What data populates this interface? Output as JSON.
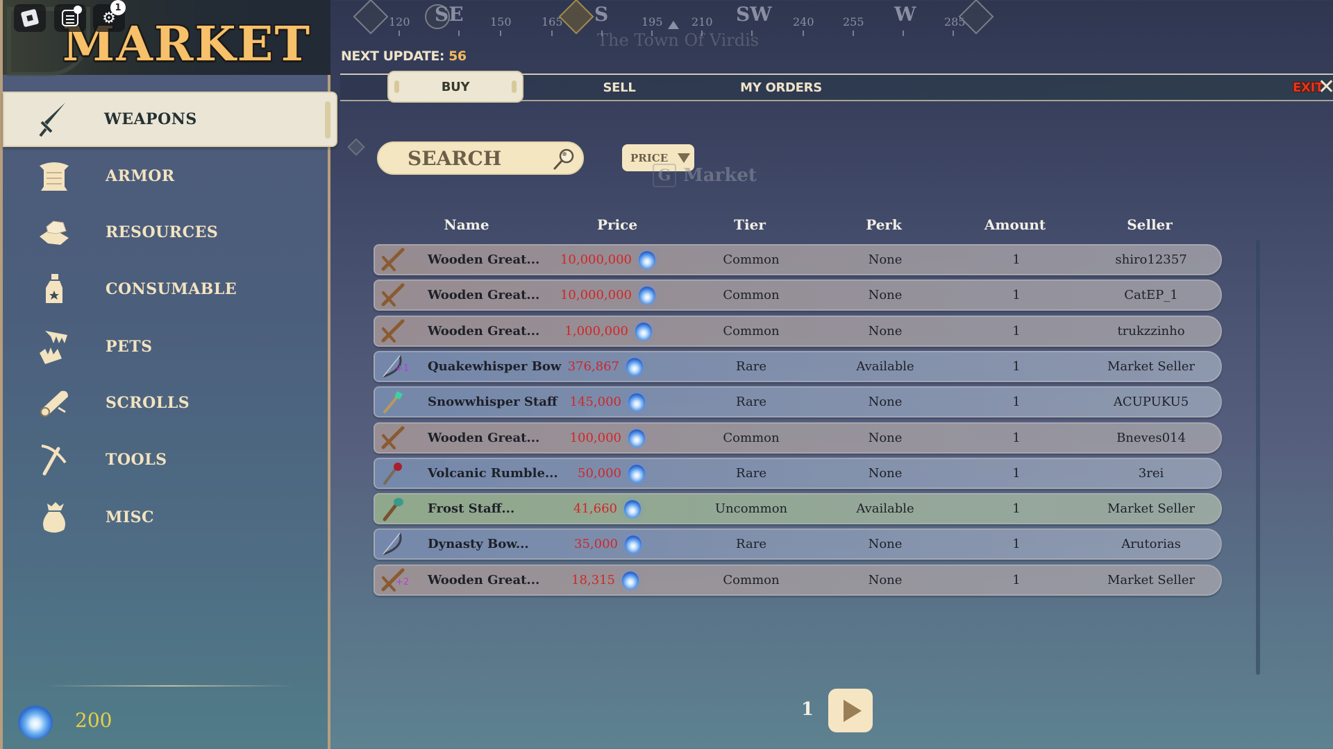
{
  "header": {
    "title": "MARKET",
    "settings_badge": "1",
    "next_update_label": "NEXT UPDATE:",
    "next_update_value": "56"
  },
  "compass": {
    "numbers": [
      "120",
      "150",
      "165",
      "195",
      "210",
      "240",
      "255",
      "285"
    ],
    "directions": [
      "SE",
      "S",
      "SW",
      "W"
    ],
    "location": "The Town Of Virdis"
  },
  "tabs": {
    "buy": "BUY",
    "sell": "SELL",
    "my_orders": "MY ORDERS",
    "exit": "EXIT",
    "active": "buy"
  },
  "sidebar": {
    "active": "WEAPONS",
    "items": [
      {
        "label": "WEAPONS",
        "icon": "sword-icon"
      },
      {
        "label": "ARMOR",
        "icon": "armor-icon"
      },
      {
        "label": "RESOURCES",
        "icon": "ingots-icon"
      },
      {
        "label": "CONSUMABLE",
        "icon": "potion-icon"
      },
      {
        "label": "PETS",
        "icon": "jaws-icon"
      },
      {
        "label": "SCROLLS",
        "icon": "scroll-icon"
      },
      {
        "label": "TOOLS",
        "icon": "pickaxe-icon"
      },
      {
        "label": "MISC",
        "icon": "pouch-icon"
      }
    ],
    "currency": {
      "icon": "spirit-flame-icon",
      "amount": "200"
    }
  },
  "search": {
    "placeholder": "SEARCH",
    "value": ""
  },
  "sort": {
    "selected": "PRICE"
  },
  "ghost_prompt": {
    "key": "G",
    "label": "Market"
  },
  "table": {
    "columns": [
      "Name",
      "Price",
      "Tier",
      "Perk",
      "Amount",
      "Seller"
    ],
    "rows": [
      {
        "name": "Wooden Great...",
        "price": "10,000,000",
        "tier": "Common",
        "perk": "None",
        "amount": "1",
        "seller": "shiro12357",
        "icon": "wooden-greatsword-icon",
        "enchant": ""
      },
      {
        "name": "Wooden Great...",
        "price": "10,000,000",
        "tier": "Common",
        "perk": "None",
        "amount": "1",
        "seller": "CatEP_1",
        "icon": "wooden-greatsword-icon",
        "enchant": ""
      },
      {
        "name": "Wooden Great...",
        "price": "1,000,000",
        "tier": "Common",
        "perk": "None",
        "amount": "1",
        "seller": "trukzzinho",
        "icon": "wooden-greatsword-icon",
        "enchant": ""
      },
      {
        "name": "Quakewhisper Bow",
        "price": "376,867",
        "tier": "Rare",
        "perk": "Available",
        "amount": "1",
        "seller": "Market Seller",
        "icon": "bow-icon",
        "enchant": "+1"
      },
      {
        "name": "Snowwhisper Staff",
        "price": "145,000",
        "tier": "Rare",
        "perk": "None",
        "amount": "1",
        "seller": "ACUPUKU5",
        "icon": "crystal-staff-icon",
        "enchant": ""
      },
      {
        "name": "Wooden Great...",
        "price": "100,000",
        "tier": "Common",
        "perk": "None",
        "amount": "1",
        "seller": "Bneves014",
        "icon": "wooden-greatsword-icon",
        "enchant": ""
      },
      {
        "name": "Volcanic Rumble...",
        "price": "50,000",
        "tier": "Rare",
        "perk": "None",
        "amount": "1",
        "seller": "3rei",
        "icon": "volcanic-staff-icon",
        "enchant": ""
      },
      {
        "name": "Frost Staff...",
        "price": "41,660",
        "tier": "Uncommon",
        "perk": "Available",
        "amount": "1",
        "seller": "Market Seller",
        "icon": "frost-staff-icon",
        "enchant": ""
      },
      {
        "name": "Dynasty Bow...",
        "price": "35,000",
        "tier": "Rare",
        "perk": "None",
        "amount": "1",
        "seller": "Arutorias",
        "icon": "bow-icon",
        "enchant": ""
      },
      {
        "name": "Wooden Great...",
        "price": "18,315",
        "tier": "Common",
        "perk": "None",
        "amount": "1",
        "seller": "Market Seller",
        "icon": "wooden-greatsword-icon",
        "enchant": "+2"
      }
    ]
  },
  "pagination": {
    "current_page": "1"
  },
  "colors": {
    "title_gold": "#f7c06a",
    "price_red": "#d02628",
    "exit_red": "#e8331c",
    "currency_yellow": "#e8cf4a",
    "enchant_purple": "#c03ad8"
  }
}
